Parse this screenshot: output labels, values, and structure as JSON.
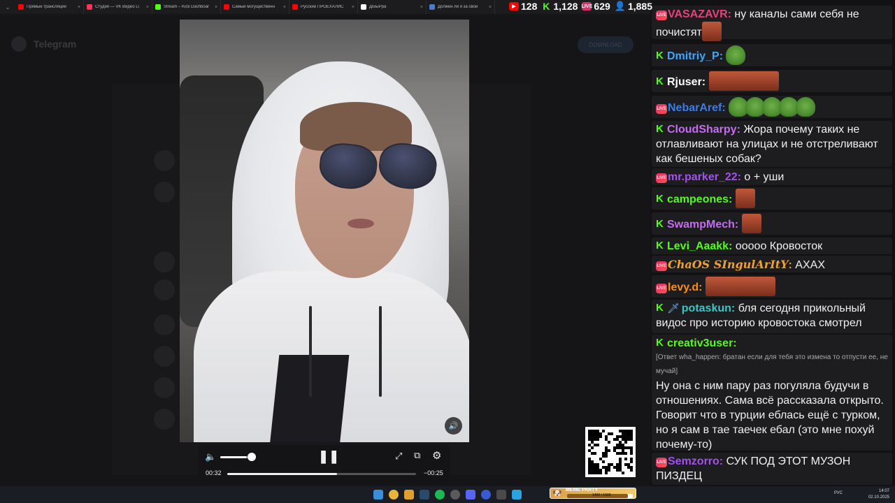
{
  "browser": {
    "tabs": [
      {
        "title": "Прямые трансляции",
        "color": "#ff0000"
      },
      {
        "title": "Студия — VK Видео Li",
        "color": "#ff3355"
      },
      {
        "title": "Stream – Kick Dashboar",
        "color": "#53fc18"
      },
      {
        "title": "Самый могущественн",
        "color": "#ff0000"
      },
      {
        "title": "Русские ПРОЕХАЛИС",
        "color": "#ff0000"
      },
      {
        "title": "ДЫыРра",
        "color": "#ffffff"
      },
      {
        "title": "Должен ли я за свой",
        "color": "#4a7bd0"
      }
    ]
  },
  "counters": {
    "youtube": "128",
    "kick": "1,128",
    "vk": "629",
    "total": "1,885"
  },
  "telegram": {
    "title": "Telegram",
    "download": "DOWNLOAD"
  },
  "player": {
    "elapsed": "00:32",
    "remaining": "−00:25",
    "volume_level": 0.85,
    "progress": 0.58
  },
  "chat": {
    "messages": [
      {
        "platform": "live",
        "user": "VASAZAVR",
        "color": "#e8407a",
        "text": "ну каналы сами себя не почистят",
        "emotes": [
          "face"
        ]
      },
      {
        "platform": "kick",
        "user": "Dmitriy_P",
        "color": "#3ea6ff",
        "text": "",
        "emotes": [
          "frog"
        ]
      },
      {
        "platform": "kick",
        "user": "Rjuser",
        "color": "#ffffff",
        "text": "",
        "emotes": [
          "face",
          "face",
          "face",
          "face"
        ]
      },
      {
        "platform": "live",
        "user": "NebarAref",
        "color": "#3b7ce8",
        "text": "",
        "emotes": [
          "frog",
          "frog",
          "frog",
          "frog",
          "frog"
        ]
      },
      {
        "platform": "kick",
        "user": "CloudSharpy",
        "color": "#c56cf0",
        "text": "Жора почему таких не отлавливают на улицах и не отстреливают как бешеных собак?",
        "emotes": []
      },
      {
        "platform": "live",
        "user": "mr.parker_22",
        "color": "#a350f0",
        "text": "о + уши",
        "emotes": []
      },
      {
        "platform": "kick",
        "user": "campeones",
        "color": "#53fc18",
        "text": "",
        "emotes": [
          "face"
        ]
      },
      {
        "platform": "kick",
        "user": "SwampMech",
        "color": "#c56cf0",
        "text": "",
        "emotes": [
          "face"
        ]
      },
      {
        "platform": "kick",
        "user": "Levi_Aaakk",
        "color": "#53fc18",
        "text": "ооооо Кровосток",
        "emotes": []
      },
      {
        "platform": "live",
        "user": "ChaOS SIngulArItY",
        "color": "#f0a030",
        "text": "АХАХ",
        "emotes": []
      },
      {
        "platform": "live",
        "user": "levy.d",
        "color": "#ff8c1a",
        "text": "",
        "emotes": [
          "face",
          "face",
          "face",
          "face"
        ]
      },
      {
        "platform": "kick",
        "user": "potaskun",
        "color": "#3ec5c5",
        "text": "бля сегодня прикольный видос про историю кровостока смотрел",
        "emotes": []
      },
      {
        "platform": "kick",
        "user": "creativ3user",
        "color": "#53fc18",
        "reply": "[Ответ wha_happen: братан если для тебя это измена то отпусти ее, не мучай]",
        "text": "Ну она с ним пару раз погуляла будучи в отношениях. Сама всё рассказала открыто. Говорит что в турции еблась ещё с турком, но я сам в тае таечек ебал (это мне похуй почему-то)",
        "emotes": []
      },
      {
        "platform": "live",
        "user": "Semzorro",
        "color": "#a350f0",
        "text": "СУК ПОД ЭТОТ МУЗОН ПИЗДЕЦ",
        "emotes": []
      }
    ]
  },
  "meme_party": {
    "title": "MEME PARTY",
    "count": "1400 / 1500",
    "fill": 0.93
  },
  "tray": {
    "lang": "РУС",
    "time": "14:07",
    "date": "02.10.2025"
  }
}
